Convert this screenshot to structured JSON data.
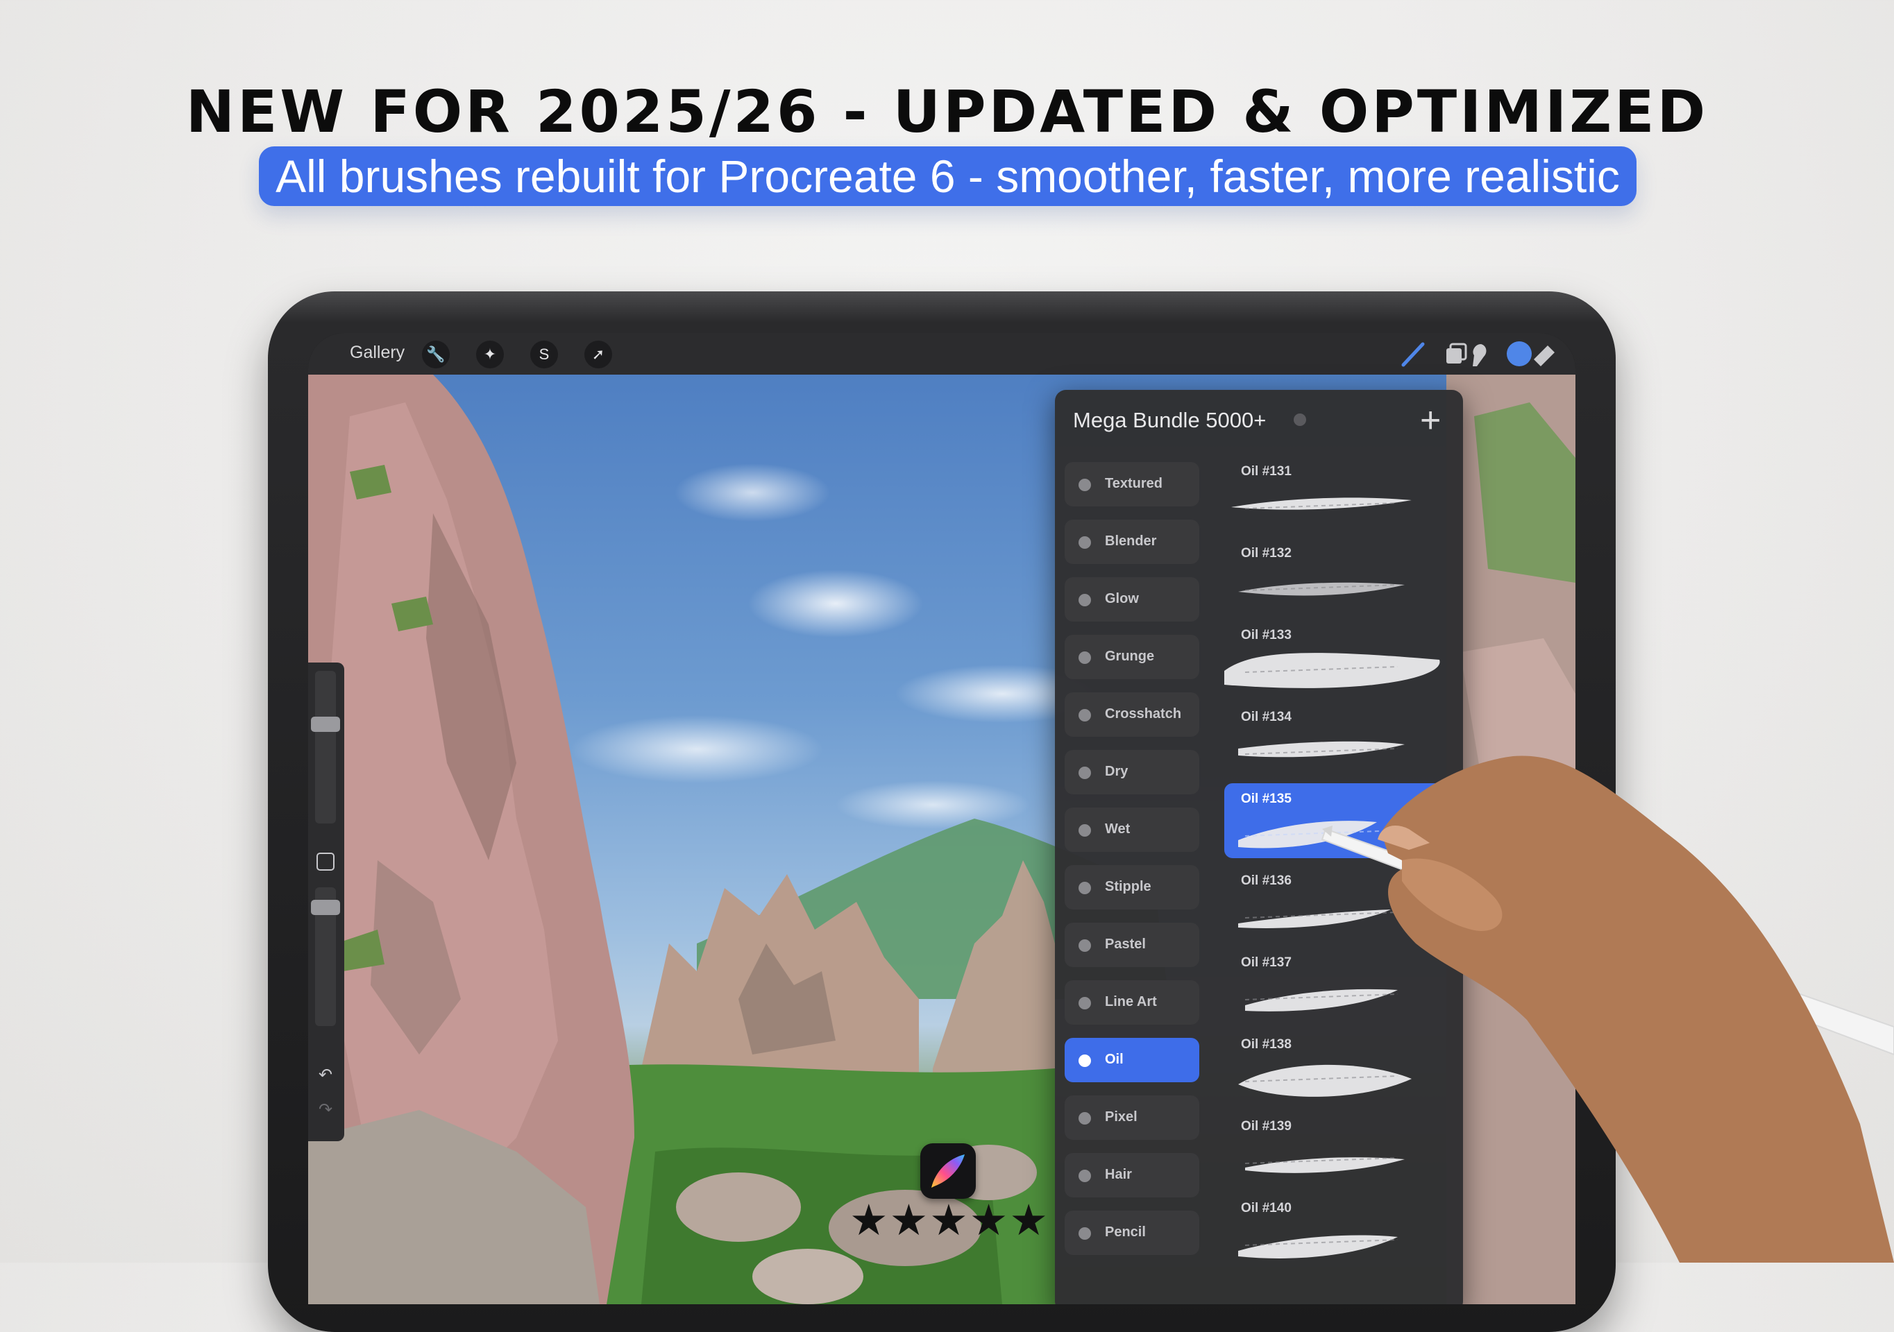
{
  "headline": "NEW FOR 2025/26 - UPDATED & OPTIMIZED",
  "banner": "All brushes rebuilt for Procreate 6 - smoother, faster, more realistic",
  "topbar": {
    "gallery_label": "Gallery",
    "left_tools": [
      "wrench-icon",
      "magic-wand-icon",
      "selection-icon",
      "transform-arrow-icon"
    ],
    "right_tools": [
      "brush-icon",
      "smudge-icon",
      "eraser-icon",
      "layers-icon"
    ],
    "active_color": "#4f86e8"
  },
  "brush_panel": {
    "title": "Mega Bundle 5000+",
    "categories": [
      {
        "label": "Textured",
        "active": false
      },
      {
        "label": "Blender",
        "active": false
      },
      {
        "label": "Glow",
        "active": false
      },
      {
        "label": "Grunge",
        "active": false
      },
      {
        "label": "Crosshatch",
        "active": false
      },
      {
        "label": "Dry",
        "active": false
      },
      {
        "label": "Wet",
        "active": false
      },
      {
        "label": "Stipple",
        "active": false
      },
      {
        "label": "Pastel",
        "active": false
      },
      {
        "label": "Line Art",
        "active": false
      },
      {
        "label": "Oil",
        "active": true
      },
      {
        "label": "Pixel",
        "active": false
      },
      {
        "label": "Hair",
        "active": false
      },
      {
        "label": "Pencil",
        "active": false
      }
    ],
    "brushes": [
      {
        "label": "Oil #131",
        "active": false
      },
      {
        "label": "Oil #132",
        "active": false
      },
      {
        "label": "Oil #133",
        "active": false
      },
      {
        "label": "Oil #134",
        "active": false
      },
      {
        "label": "Oil #135",
        "active": true
      },
      {
        "label": "Oil #136",
        "active": false
      },
      {
        "label": "Oil #137",
        "active": false
      },
      {
        "label": "Oil #138",
        "active": false
      },
      {
        "label": "Oil #139",
        "active": false
      },
      {
        "label": "Oil #140",
        "active": false
      }
    ]
  },
  "rating": "★★★★★",
  "accent_color": "#3e6de9"
}
